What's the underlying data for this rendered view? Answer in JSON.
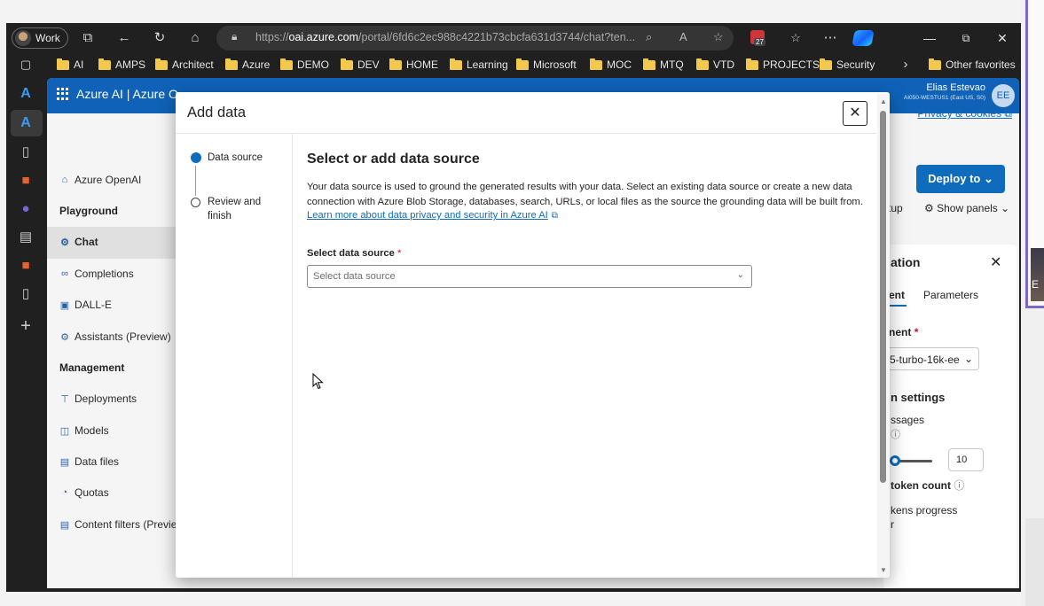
{
  "browser": {
    "profile_label": "Work",
    "url_host": "oai.azure.com",
    "url_prefix": "https://",
    "url_path": "/portal/6fd6c2ec988c4221b73cbcfa631d3744/chat?ten...",
    "extension_badge": "27"
  },
  "favorites": {
    "items": [
      "AI",
      "AMPS",
      "Architect",
      "Azure",
      "DEMO",
      "DEV",
      "HOME",
      "Learning",
      "Microsoft",
      "MOC",
      "MTQ",
      "VTD",
      "PROJECTS",
      "Security"
    ],
    "other_label": "Other favorites"
  },
  "portal": {
    "brand": "Azure AI  |  Azure O",
    "user_name": "Elias Estevao",
    "user_org": "AI050-WESTUS1 (East US, S0)",
    "user_initials": "EE",
    "privacy_link": "Privacy & cookies",
    "deploy_button": "Deploy to",
    "setup_label": "tup",
    "show_panels": "Show panels"
  },
  "leftnav": {
    "home": "Azure OpenAI",
    "playground_head": "Playground",
    "chat": "Chat",
    "completions": "Completions",
    "dalle": "DALL-E",
    "assistants": "Assistants (Preview)",
    "management_head": "Management",
    "deployments": "Deployments",
    "models": "Models",
    "data_files": "Data files",
    "quotas": "Quotas",
    "content_filters": "Content filters (Preview"
  },
  "config_panel": {
    "title": "ation",
    "tab_deployment": "ent",
    "tab_parameters": "Parameters",
    "deployment_label": "nent",
    "deployment_value": "5-turbo-16k-ee",
    "section": "n settings",
    "past_messages": "ssages",
    "past_messages_value": "10",
    "token_count": "token count",
    "tokens_progress": "kens progress",
    "tokens_progress_2": "r"
  },
  "dialog": {
    "title": "Add data",
    "steps": [
      {
        "label": "Data source"
      },
      {
        "label": "Review and finish"
      }
    ],
    "heading": "Select or add data source",
    "description": "Your data source is used to ground the generated results with your data. Select an existing data source or create a new data connection with Azure Blob Storage, databases, search, URLs, or local files as the source the grounding data will be built from.",
    "learn_more": "Learn more about data privacy and security in Azure AI",
    "field_label": "Select data source",
    "required_mark": "*",
    "select_placeholder": "Select data source"
  }
}
